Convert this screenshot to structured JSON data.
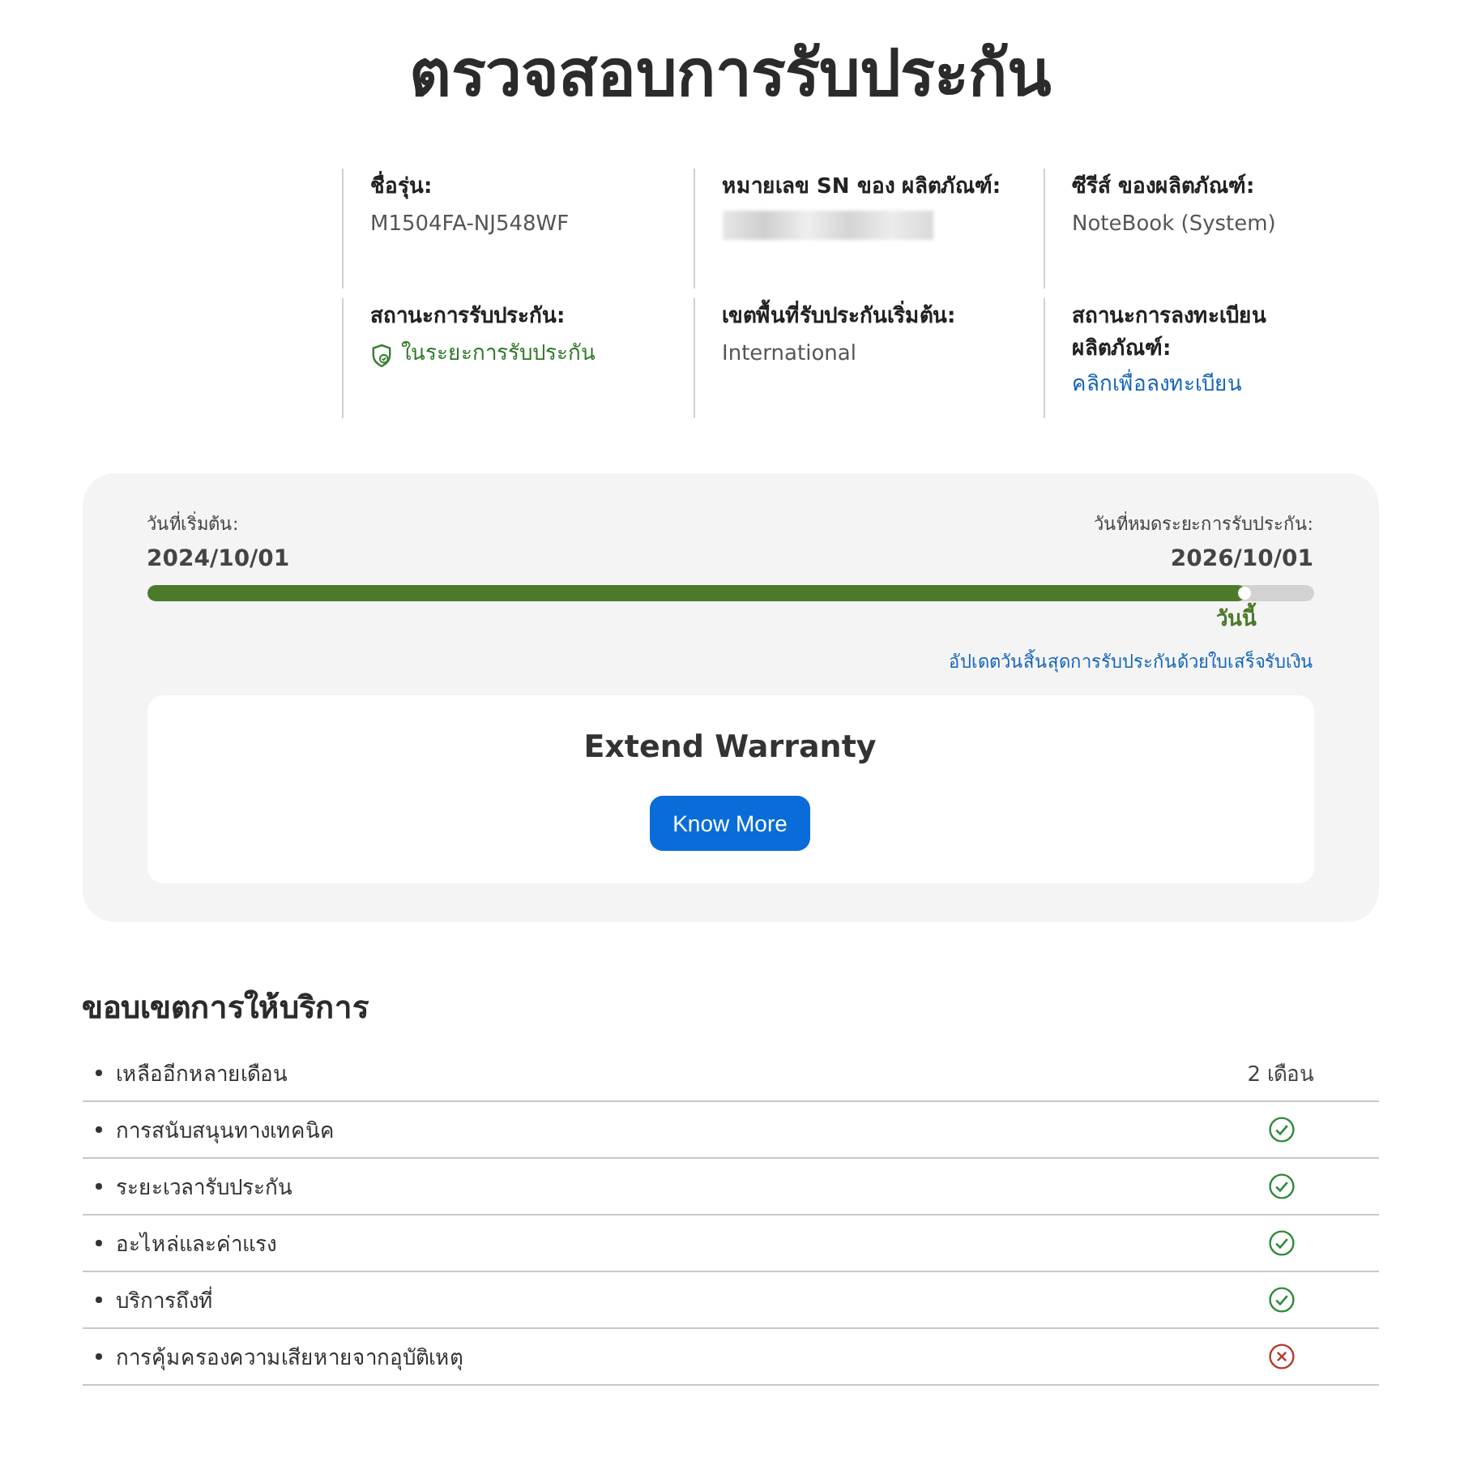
{
  "page_title": "ตรวจสอบการรับประกัน",
  "product_info": [
    {
      "label": "ชื่อรุ่น:",
      "kind": "text",
      "value": "M1504FA-NJ548WF"
    },
    {
      "label": "หมายเลข SN ของ ผลิตภัณฑ์:",
      "kind": "redacted"
    },
    {
      "label": "ซีรีส์ ของผลิตภัณฑ์:",
      "kind": "text",
      "value": "NoteBook (System)"
    },
    {
      "label": "สถานะการรับประกัน:",
      "kind": "status",
      "value": "ในระยะการรับประกัน"
    },
    {
      "label": "เขตพื้นที่รับประกันเริ่มต้น:",
      "kind": "text",
      "value": "International"
    },
    {
      "label": "สถานะการลงทะเบียน ผลิตภัณฑ์:",
      "kind": "link",
      "value": "คลิกเพื่อลงทะเบียน"
    }
  ],
  "warranty_period": {
    "start_label": "วันที่เริ่มต้น:",
    "start_date": "2024/10/01",
    "end_label": "วันที่หมดระยะการรับประกัน:",
    "end_date": "2026/10/01",
    "progress": {
      "level": 0.943,
      "marker_label": "วันนี้"
    },
    "update_link": "อัปเดตวันสิ้นสุดการรับประกันด้วยใบเสร็จรับเงิน",
    "extend": {
      "title": "Extend Warranty",
      "button": "Know More"
    }
  },
  "service_scope": {
    "title": "ขอบเขตการให้บริการ",
    "rows": [
      {
        "label": "เหลืออีกหลายเดือน",
        "kind": "text",
        "value": "2 เดือน"
      },
      {
        "label": "การสนับสนุนทางเทคนิค",
        "kind": "status",
        "included": true
      },
      {
        "label": "ระยะเวลารับประกัน",
        "kind": "status",
        "included": true
      },
      {
        "label": "อะไหล่และค่าแรง",
        "kind": "status",
        "included": true
      },
      {
        "label": "บริการถึงที่",
        "kind": "status",
        "included": true
      },
      {
        "label": "การคุ้มครองความเสียหายจากอุบัติเหตุ",
        "kind": "status",
        "included": false
      }
    ]
  }
}
